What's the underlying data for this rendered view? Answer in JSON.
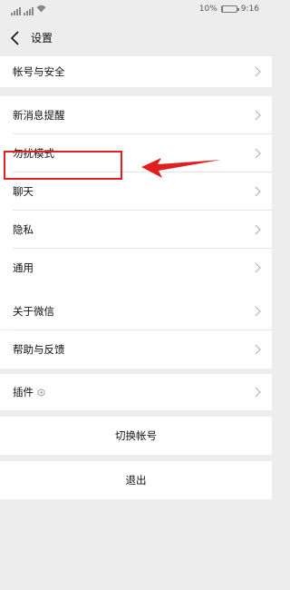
{
  "status": {
    "battery": "10%",
    "battery_level": 0.1,
    "time": "9:16"
  },
  "nav": {
    "title": "设置"
  },
  "menu": {
    "account_security": "帐号与安全",
    "new_message_alerts": "新消息提醒",
    "do_not_disturb": "勿扰模式",
    "chats": "聊天",
    "privacy": "隐私",
    "general": "通用",
    "about": "关于微信",
    "help_feedback": "帮助与反馈",
    "plugins": "插件",
    "switch_account": "切换帐号",
    "logout": "退出"
  },
  "annotation": {
    "color": "#e02020"
  },
  "icons": [
    "signal-icon",
    "wifi-icon",
    "battery-icon",
    "back-arrow-icon",
    "chevron-right-icon",
    "plugin-icon",
    "pointer-arrow"
  ]
}
